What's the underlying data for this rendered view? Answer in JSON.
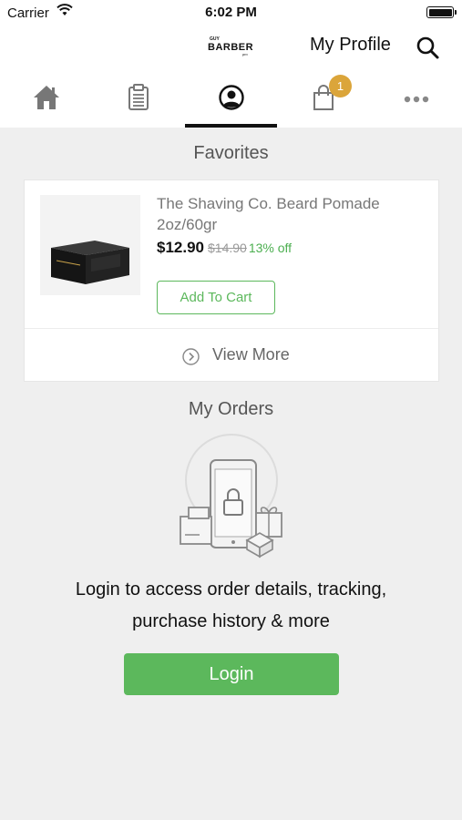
{
  "status_bar": {
    "carrier": "Carrier",
    "time": "6:02 PM"
  },
  "header": {
    "logo": {
      "top": "GUY",
      "main": "BARBER",
      "sub": "pro"
    },
    "title": "My Profile"
  },
  "tabs": [
    {
      "name": "home",
      "icon": "home-icon"
    },
    {
      "name": "orders",
      "icon": "clipboard-icon"
    },
    {
      "name": "profile",
      "icon": "user-circle-icon",
      "active": true
    },
    {
      "name": "cart",
      "icon": "shopping-bag-icon",
      "badge": "1"
    },
    {
      "name": "more",
      "icon": "more-dots-icon"
    }
  ],
  "favorites": {
    "title": "Favorites",
    "product": {
      "name": "The Shaving Co. Beard Pomade 2oz/60gr",
      "price": "$12.90",
      "old_price": "$14.90",
      "discount": "13% off",
      "add_to_cart": "Add To Cart"
    },
    "view_more": "View More"
  },
  "orders": {
    "title": "My Orders",
    "login_text_line1": "Login to access order details, tracking,",
    "login_text_line2": "purchase history & more",
    "login_button": "Login"
  },
  "colors": {
    "accent_green": "#5cb85c",
    "badge_gold": "#dba53a"
  }
}
